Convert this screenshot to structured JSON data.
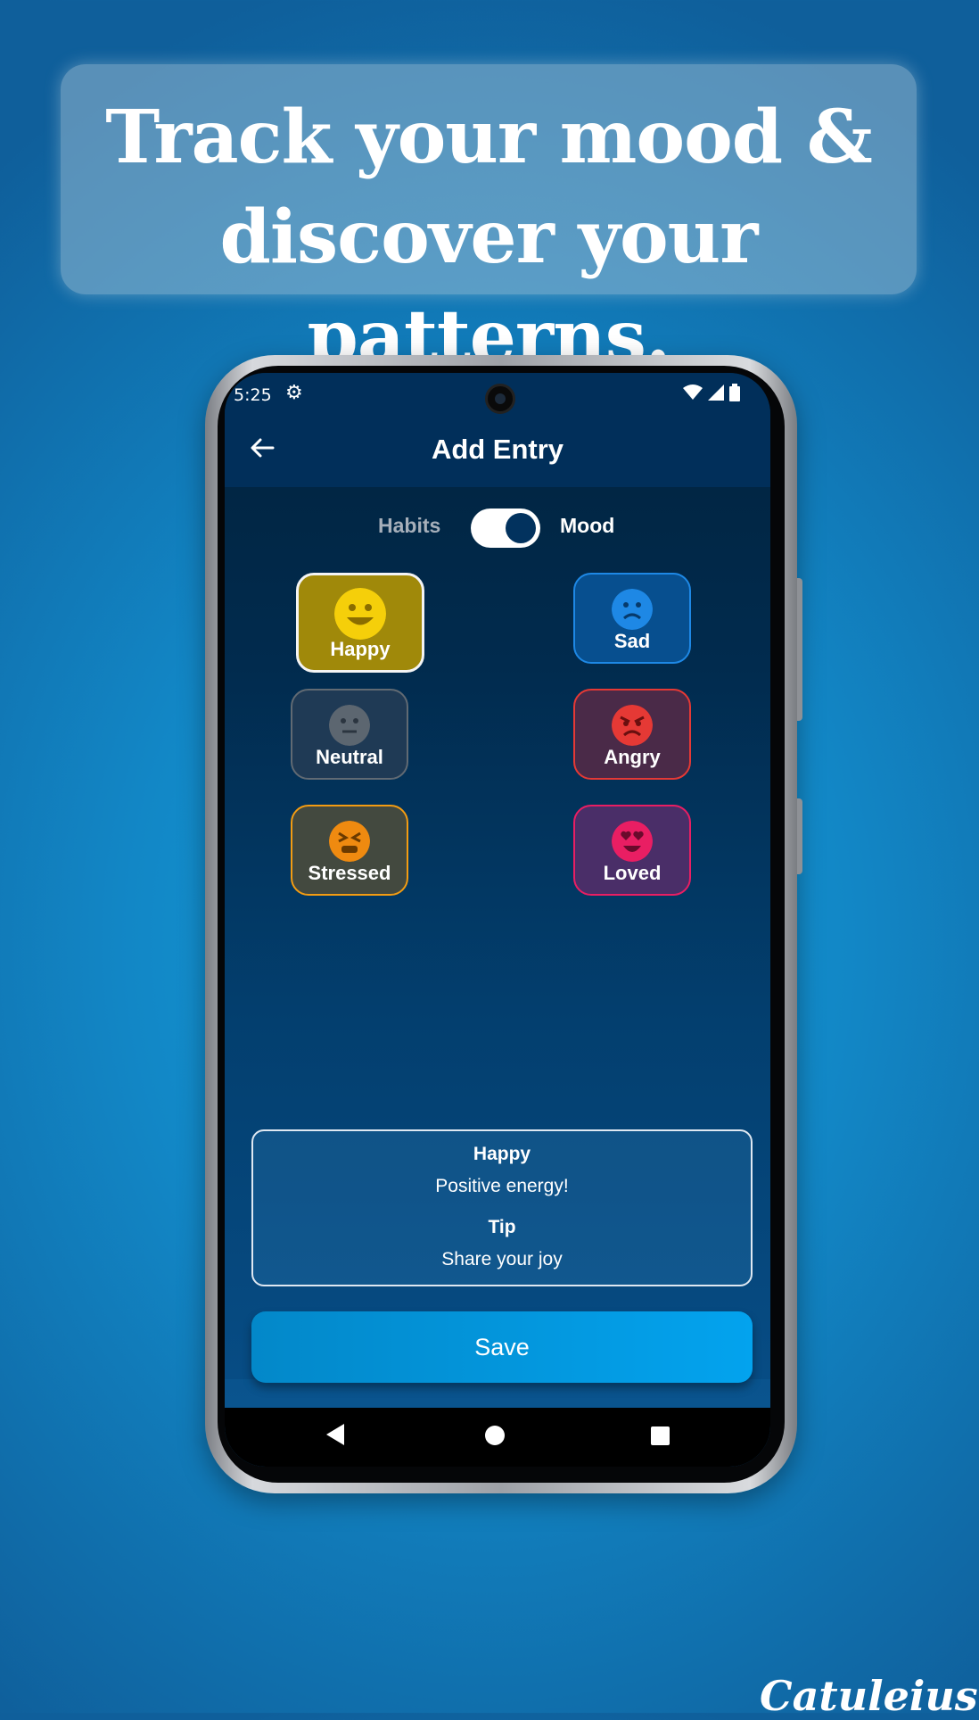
{
  "headline": {
    "line1": "Track your mood &",
    "line2": "discover your patterns."
  },
  "status": {
    "time": "5:25"
  },
  "appbar": {
    "title": "Add Entry"
  },
  "toggle": {
    "left_label": "Habits",
    "right_label": "Mood",
    "state": "Mood"
  },
  "moods": [
    {
      "label": "Happy",
      "color": "#f1c40f",
      "selected": true
    },
    {
      "label": "Sad",
      "color": "#1e88e5",
      "selected": false
    },
    {
      "label": "Neutral",
      "color": "#616a73",
      "selected": false
    },
    {
      "label": "Angry",
      "color": "#e53935",
      "selected": false
    },
    {
      "label": "Stressed",
      "color": "#f39c12",
      "selected": false
    },
    {
      "label": "Loved",
      "color": "#e91e63",
      "selected": false
    }
  ],
  "info": {
    "title": "Happy",
    "message": "Positive energy!",
    "tip_title": "Tip",
    "tip": "Share your joy"
  },
  "save_label": "Save",
  "brand": "Catuleius"
}
